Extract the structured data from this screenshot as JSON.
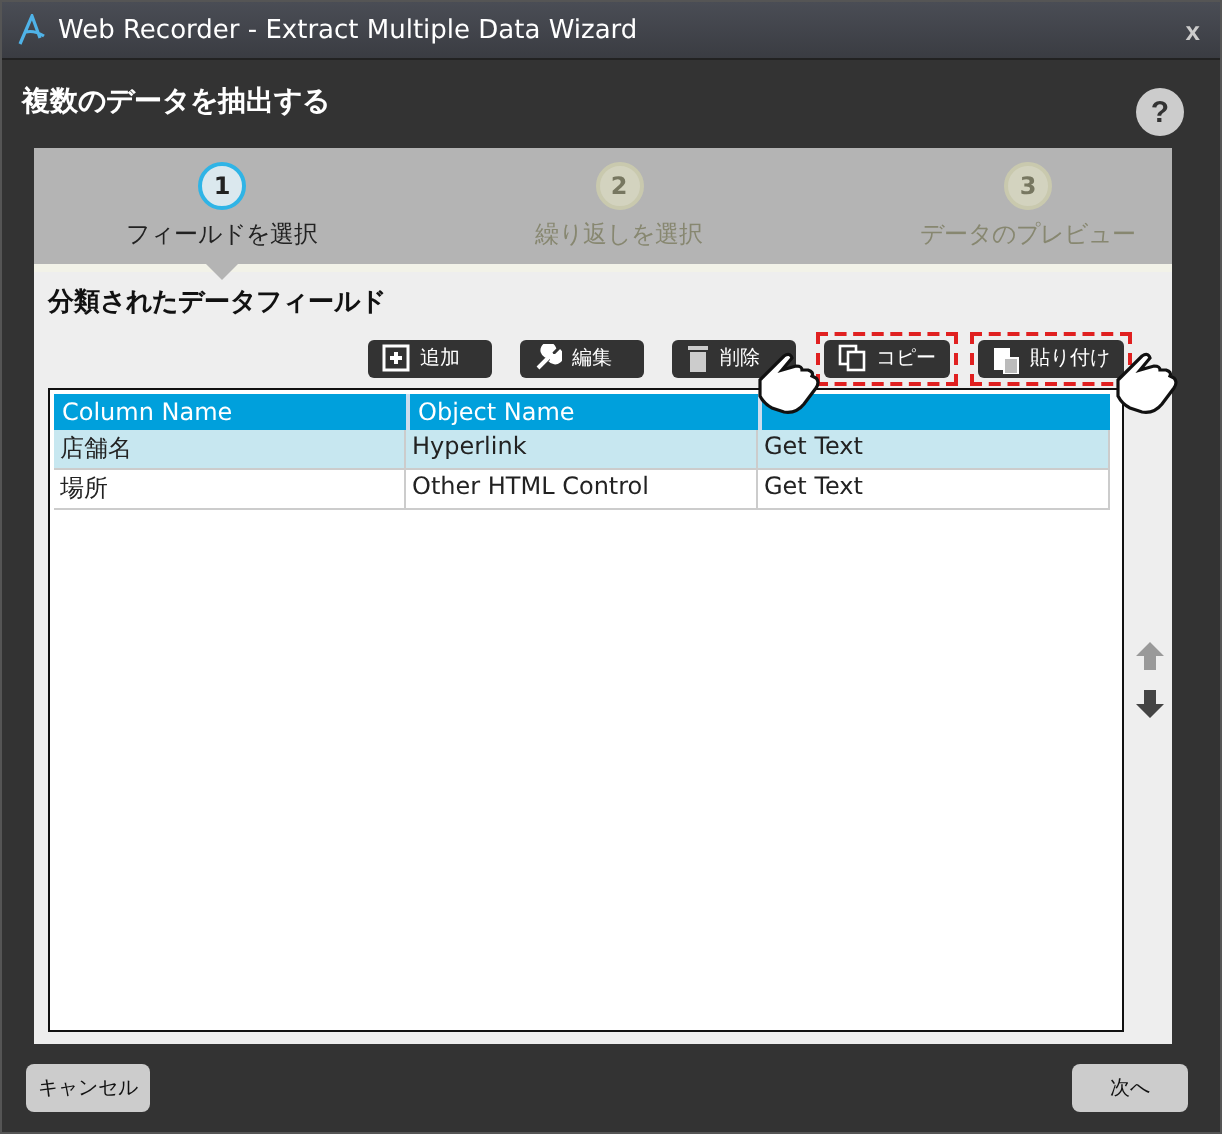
{
  "window": {
    "title": "Web Recorder - Extract Multiple Data Wizard",
    "close": "x"
  },
  "heading": "複数のデータを抽出する",
  "help": "?",
  "steps": [
    {
      "number": "1",
      "label": "フィールドを選択",
      "selected": true
    },
    {
      "number": "2",
      "label": "繰り返しを選択",
      "selected": false
    },
    {
      "number": "3",
      "label": "データのプレビュー",
      "selected": false
    }
  ],
  "section_title": "分類されたデータフィールド",
  "toolbar": [
    {
      "kind": "add",
      "label": "追加",
      "highlighted": false,
      "pointer": false
    },
    {
      "kind": "edit",
      "label": "編集",
      "highlighted": false,
      "pointer": false
    },
    {
      "kind": "delete",
      "label": "削除",
      "highlighted": false,
      "pointer": false
    },
    {
      "kind": "copy",
      "label": "コピー",
      "highlighted": true,
      "pointer": true
    },
    {
      "kind": "paste",
      "label": "貼り付け",
      "highlighted": true,
      "pointer": true
    }
  ],
  "table": {
    "columns": [
      "Column Name",
      "Object Name"
    ],
    "rows": [
      {
        "cells": [
          "店舗名",
          "Hyperlink",
          "Get Text"
        ],
        "selected": true
      },
      {
        "cells": [
          "場所",
          "Other HTML Control",
          "Get Text"
        ],
        "selected": false
      }
    ]
  },
  "move_buttons": [
    {
      "kind": "up",
      "disabled": true
    },
    {
      "kind": "down",
      "disabled": false
    }
  ],
  "buttons": {
    "cancel": "キャンセル",
    "next": "次へ"
  }
}
